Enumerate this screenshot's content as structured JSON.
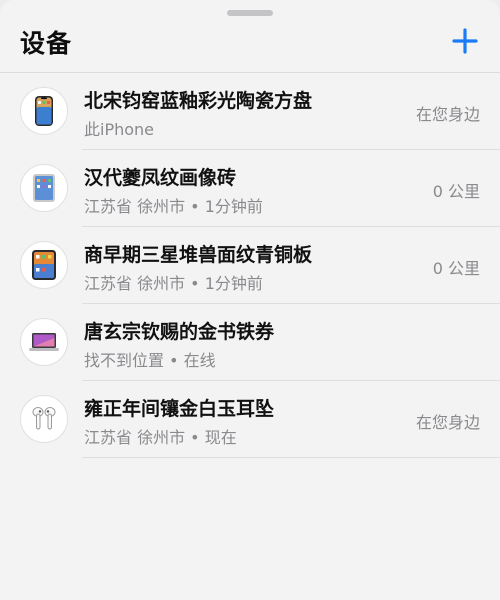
{
  "header": {
    "title": "设备",
    "add_icon": "plus-icon",
    "accent_color": "#1a7cf5"
  },
  "devices": [
    {
      "name": "北宋钧窑蓝釉彩光陶瓷方盘",
      "subtitle": "此iPhone",
      "distance": "在您身边",
      "icon": "iphone-icon"
    },
    {
      "name": "汉代夔凤纹画像砖",
      "subtitle": "江苏省 徐州市 • 1分钟前",
      "distance": "0 公里",
      "icon": "ipad-icon"
    },
    {
      "name": "商早期三星堆兽面纹青铜板",
      "subtitle": "江苏省 徐州市 • 1分钟前",
      "distance": "0 公里",
      "icon": "ipad-icon"
    },
    {
      "name": "唐玄宗钦赐的金书铁券",
      "subtitle": "找不到位置 • 在线",
      "distance": "",
      "icon": "macbook-icon"
    },
    {
      "name": "雍正年间镶金白玉耳坠",
      "subtitle": "江苏省 徐州市 • 现在",
      "distance": "在您身边",
      "icon": "airpods-icon"
    }
  ]
}
